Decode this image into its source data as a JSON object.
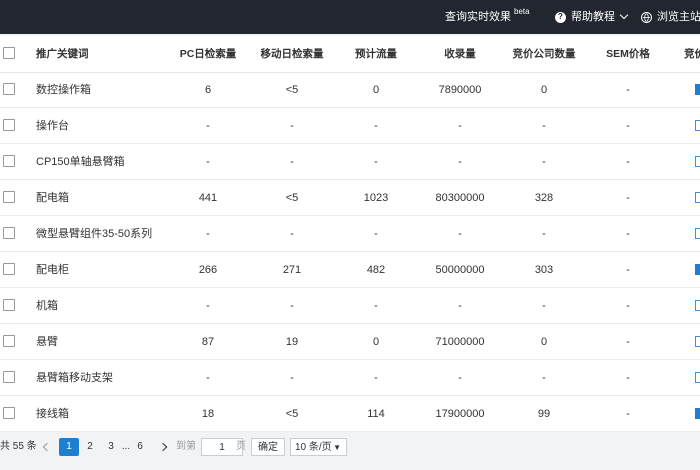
{
  "topbar": {
    "query_effect": "查询实时效果",
    "beta": "beta",
    "help": "帮助教程",
    "browse": "浏览主站"
  },
  "table": {
    "headers": {
      "keyword": "推广关键词",
      "pc": "PC日检索量",
      "mobile": "移动日检索量",
      "estimate": "预计流量",
      "included": "收录量",
      "competitors": "竞价公司数量",
      "sem": "SEM价格",
      "last": "竞价"
    },
    "rows": [
      {
        "keyword": "数控操作箱",
        "pc": "6",
        "mobile": "<5",
        "estimate": "0",
        "included": "7890000",
        "competitors": "0",
        "sem": "-",
        "bar_filled": true
      },
      {
        "keyword": "操作台",
        "pc": "-",
        "mobile": "-",
        "estimate": "-",
        "included": "-",
        "competitors": "-",
        "sem": "-",
        "bar_filled": false
      },
      {
        "keyword": "CP150单轴悬臂箱",
        "pc": "-",
        "mobile": "-",
        "estimate": "-",
        "included": "-",
        "competitors": "-",
        "sem": "-",
        "bar_filled": false
      },
      {
        "keyword": "配电箱",
        "pc": "441",
        "mobile": "<5",
        "estimate": "1023",
        "included": "80300000",
        "competitors": "328",
        "sem": "-",
        "bar_filled": false
      },
      {
        "keyword": "微型悬臂组件35-50系列",
        "pc": "-",
        "mobile": "-",
        "estimate": "-",
        "included": "-",
        "competitors": "-",
        "sem": "-",
        "bar_filled": false
      },
      {
        "keyword": "配电柜",
        "pc": "266",
        "mobile": "271",
        "estimate": "482",
        "included": "50000000",
        "competitors": "303",
        "sem": "-",
        "bar_filled": true
      },
      {
        "keyword": "机箱",
        "pc": "-",
        "mobile": "-",
        "estimate": "-",
        "included": "-",
        "competitors": "-",
        "sem": "-",
        "bar_filled": false
      },
      {
        "keyword": "悬臂",
        "pc": "87",
        "mobile": "19",
        "estimate": "0",
        "included": "71000000",
        "competitors": "0",
        "sem": "-",
        "bar_filled": false
      },
      {
        "keyword": "悬臂箱移动支架",
        "pc": "-",
        "mobile": "-",
        "estimate": "-",
        "included": "-",
        "competitors": "-",
        "sem": "-",
        "bar_filled": false
      },
      {
        "keyword": "接线箱",
        "pc": "18",
        "mobile": "<5",
        "estimate": "114",
        "included": "17900000",
        "competitors": "99",
        "sem": "-",
        "bar_filled": true
      }
    ]
  },
  "pager": {
    "total": "共 55 条",
    "pages": [
      "1",
      "2",
      "3"
    ],
    "ellipsis": "...",
    "last_page": "6",
    "active": "1",
    "goto_label": "到第",
    "goto_value": "1",
    "page_unit": "页",
    "confirm": "确定",
    "page_size": "10 条/页"
  },
  "colors": {
    "accent": "#1e7fd1",
    "topbar": "#22262e"
  }
}
